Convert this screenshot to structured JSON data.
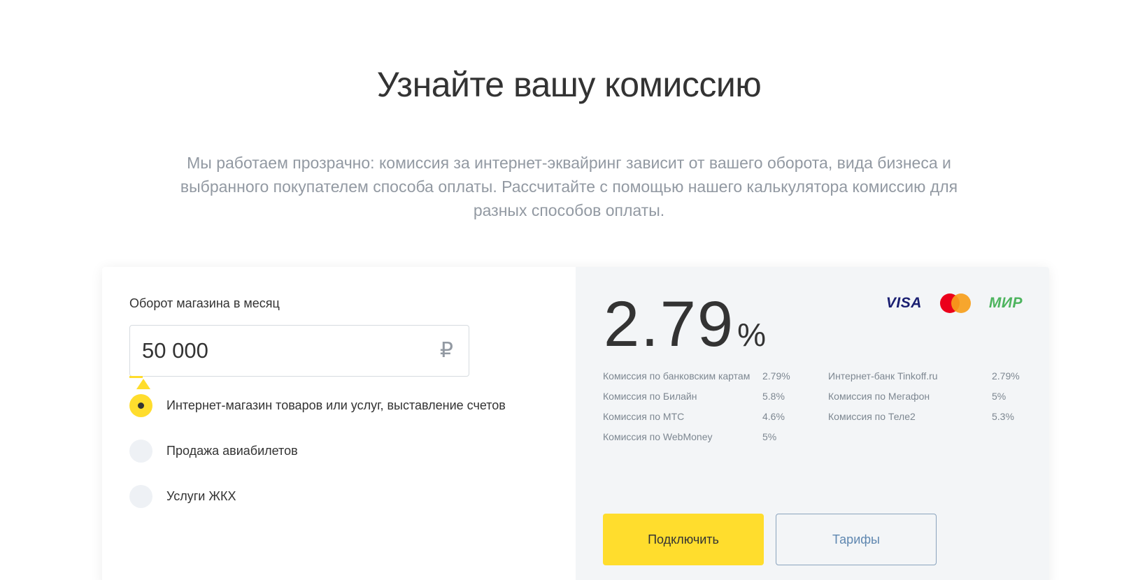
{
  "header": {
    "title": "Узнайте вашу комиссию",
    "description": "Мы работаем прозрачно: комиссия за интернет-эквайринг зависит от вашего оборота, вида бизнеса и выбранного покупателем способа оплаты. Рассчитайте с помощью нашего калькулятора комиссию для разных способов оплаты."
  },
  "calculator": {
    "turnover_label": "Оборот магазина в месяц",
    "turnover_value": "50 000",
    "currency": "₽",
    "slider_fill_fraction": 0.04,
    "business_types": [
      {
        "label": "Интернет-магазин товаров или услуг, выставление счетов",
        "selected": true
      },
      {
        "label": "Продажа авиабилетов",
        "selected": false
      },
      {
        "label": "Услуги ЖКХ",
        "selected": false
      }
    ]
  },
  "result": {
    "rate": "2.79",
    "percent_sign": "%",
    "payment_systems": [
      "VISA",
      "mastercard-logo",
      "МИР"
    ],
    "fees_left": [
      {
        "label": "Комиссия по банковским картам",
        "value": "2.79%"
      },
      {
        "label": "Комиссия по Билайн",
        "value": "5.8%"
      },
      {
        "label": "Комиссия по МТС",
        "value": "4.6%"
      },
      {
        "label": "Комиссия по WebMoney",
        "value": "5%"
      }
    ],
    "fees_right": [
      {
        "label": "Интернет-банк Tinkoff.ru",
        "value": "2.79%"
      },
      {
        "label": "Комиссия по Мегафон",
        "value": "5%"
      },
      {
        "label": "Комиссия по Теле2",
        "value": "5.3%"
      }
    ],
    "connect_label": "Подключить",
    "tariffs_label": "Тарифы"
  },
  "colors": {
    "accent_yellow": "#ffdd2d",
    "panel_gray": "#f3f5f7",
    "muted_text": "#9299a2",
    "link_blue": "#5f87b0"
  }
}
